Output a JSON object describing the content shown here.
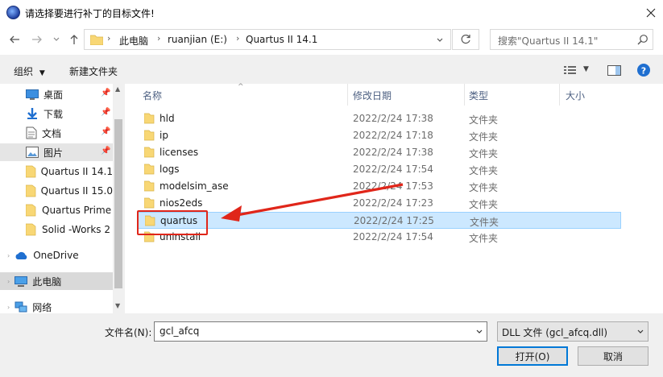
{
  "window": {
    "title": "请选择要进行补丁的目标文件!",
    "close_icon": "close-icon"
  },
  "nav": {
    "breadcrumb": [
      "此电脑",
      "ruanjian (E:)",
      "Quartus II 14.1"
    ],
    "search_placeholder": "搜索\"Quartus II 14.1\""
  },
  "toolbar": {
    "organize_label": "组织",
    "new_folder_label": "新建文件夹"
  },
  "sidebar": {
    "items": [
      {
        "label": "桌面",
        "icon": "desktop-icon",
        "pinned": true
      },
      {
        "label": "下载",
        "icon": "download-icon",
        "pinned": true
      },
      {
        "label": "文档",
        "icon": "document-icon",
        "pinned": true
      },
      {
        "label": "图片",
        "icon": "picture-icon",
        "pinned": true,
        "selected": true
      },
      {
        "label": "Quartus II 14.1",
        "icon": "folder-icon"
      },
      {
        "label": "Quartus II 15.0",
        "icon": "folder-icon"
      },
      {
        "label": "Quartus Prime",
        "icon": "folder-icon"
      },
      {
        "label": "Solid -Works 2",
        "icon": "folder-icon"
      },
      {
        "label": "OneDrive",
        "icon": "cloud-icon"
      },
      {
        "label": "此电脑",
        "icon": "computer-icon",
        "selected": true
      },
      {
        "label": "网络",
        "icon": "network-icon"
      }
    ]
  },
  "columns": {
    "name": "名称",
    "date": "修改日期",
    "type": "类型",
    "size": "大小"
  },
  "files": [
    {
      "name": "hld",
      "date": "2022/2/24 17:38",
      "type": "文件夹"
    },
    {
      "name": "ip",
      "date": "2022/2/24 17:18",
      "type": "文件夹"
    },
    {
      "name": "licenses",
      "date": "2022/2/24 17:38",
      "type": "文件夹"
    },
    {
      "name": "logs",
      "date": "2022/2/24 17:54",
      "type": "文件夹"
    },
    {
      "name": "modelsim_ase",
      "date": "2022/2/24 17:53",
      "type": "文件夹"
    },
    {
      "name": "nios2eds",
      "date": "2022/2/24 17:23",
      "type": "文件夹"
    },
    {
      "name": "quartus",
      "date": "2022/2/24 17:25",
      "type": "文件夹",
      "selected": true
    },
    {
      "name": "uninstall",
      "date": "2022/2/24 17:54",
      "type": "文件夹"
    }
  ],
  "bottom": {
    "filename_label": "文件名(N):",
    "filename_value": "gcl_afcq",
    "filetype_value": "DLL 文件 (gcl_afcq.dll)",
    "open_label": "打开(O)",
    "cancel_label": "取消"
  },
  "colors": {
    "folder": "#f8d775",
    "selection": "#cce8ff",
    "annotation": "#e0261a",
    "accent": "#0078d7"
  }
}
